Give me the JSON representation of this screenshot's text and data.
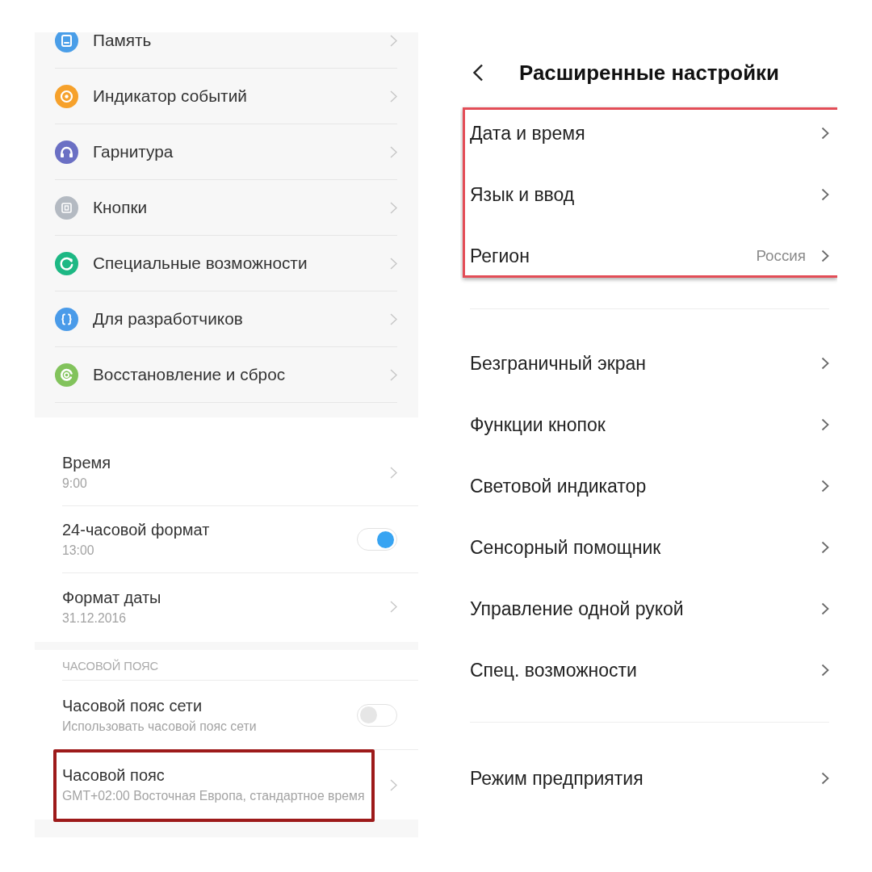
{
  "left_screen": {
    "settings_list": {
      "items": [
        {
          "label": "Память",
          "color": "#4a9ee8"
        },
        {
          "label": "Индикатор событий",
          "color": "#f6a12b"
        },
        {
          "label": "Гарнитура",
          "color": "#6b70c4"
        },
        {
          "label": "Кнопки",
          "color": "#b4bac2"
        },
        {
          "label": "Специальные возможности",
          "color": "#1db884"
        },
        {
          "label": "Для разработчиков",
          "color": "#4a9be9"
        },
        {
          "label": "Восстановление и сброс",
          "color": "#82c35c"
        }
      ]
    },
    "date_time": {
      "items": [
        {
          "kind": "link",
          "title": "Время",
          "subtitle": "9:00",
          "highlighted": false
        },
        {
          "kind": "toggle",
          "title": "24-часовой формат",
          "subtitle": "13:00",
          "on": true,
          "highlighted": false
        },
        {
          "kind": "link",
          "title": "Формат даты",
          "subtitle": "31.12.2016",
          "highlighted": false
        }
      ]
    },
    "time_zone": {
      "header": "ЧАСОВОЙ ПОЯС",
      "items": [
        {
          "kind": "toggle",
          "title": "Часовой пояс сети",
          "subtitle": "Использовать часовой пояс сети",
          "on": false,
          "highlighted": false
        },
        {
          "kind": "link",
          "title": "Часовой пояс",
          "subtitle": "GMT+02:00 Восточная Европа, стандартное время",
          "highlighted": true
        }
      ]
    }
  },
  "right_screen": {
    "title": "Расширенные настройки",
    "groups": [
      {
        "highlighted": true,
        "items": [
          {
            "label": "Дата и время"
          },
          {
            "label": "Язык и ввод"
          },
          {
            "label": "Регион",
            "value": "Россия"
          }
        ]
      },
      {
        "highlighted": false,
        "items": [
          {
            "label": "Безграничный экран"
          },
          {
            "label": "Функции кнопок"
          },
          {
            "label": "Световой индикатор"
          },
          {
            "label": "Сенсорный помощник"
          },
          {
            "label": "Управление одной рукой"
          },
          {
            "label": "Спец. возможности"
          }
        ]
      },
      {
        "highlighted": false,
        "items": [
          {
            "label": "Режим предприятия"
          }
        ]
      }
    ]
  }
}
